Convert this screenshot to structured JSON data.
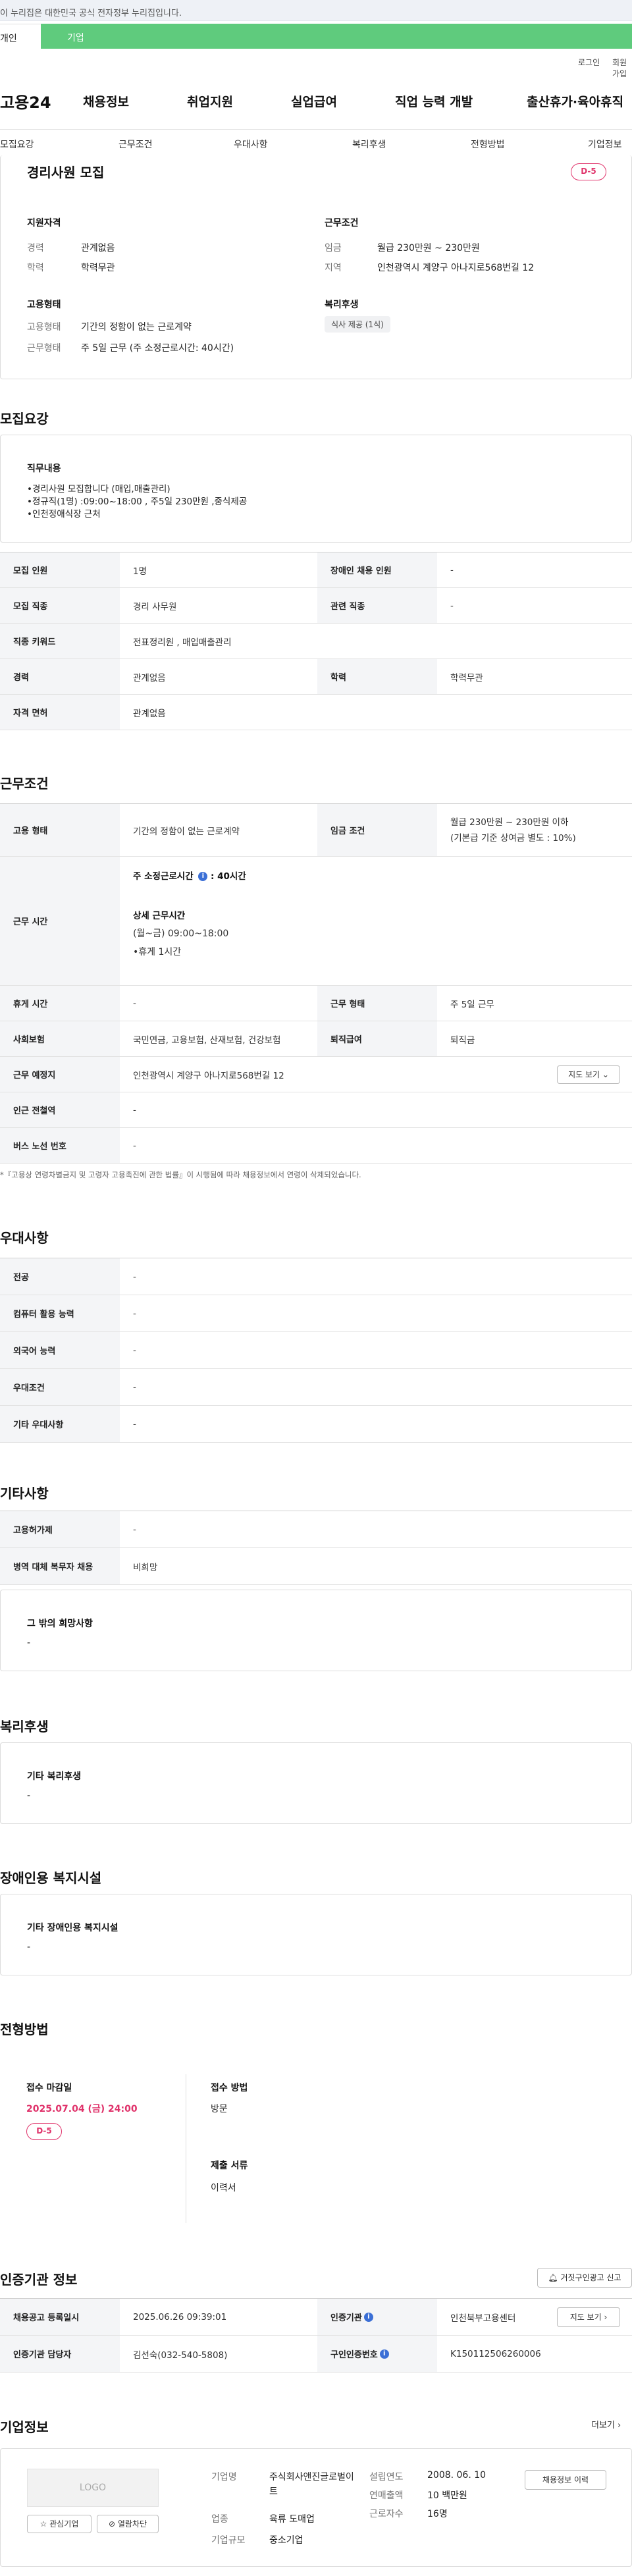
{
  "gov_banner": "이 누리집은 대한민국 공식 전자정부 누리집입니다.",
  "top_tabs": {
    "person": "개인",
    "company": "기업"
  },
  "util_links": {
    "login": "로그인",
    "join": "회원가입"
  },
  "logo": "고용24",
  "gnb": [
    "채용정보",
    "취업지원",
    "실업급여",
    "직업 능력 개발",
    "출산휴가·육아휴직"
  ],
  "anchor_nav": [
    "모집요강",
    "근무조건",
    "우대사항",
    "복리후생",
    "전형방법",
    "기업정보"
  ],
  "summary": {
    "title": "경리사원 모집",
    "dday": "D-5",
    "qual_title": "지원자격",
    "qual": [
      {
        "label": "경력",
        "value": "관계없음"
      },
      {
        "label": "학력",
        "value": "학력무관"
      }
    ],
    "work_title": "근무조건",
    "work": [
      {
        "label": "임금",
        "value": "월급 230만원 ~ 230만원"
      },
      {
        "label": "지역",
        "value": "인천광역시 계양구 아나지로568번길 12"
      }
    ],
    "emp_title": "고용형태",
    "emp": [
      {
        "label": "고용형태",
        "value": "기간의 정함이 없는 근로계약"
      },
      {
        "label": "근무형태",
        "value": "주 5일 근무 (주 소정근로시간: 40시간)"
      }
    ],
    "welfare_title": "복리후생",
    "welfare_tag": "식사 제공 (1식)"
  },
  "recruit": {
    "heading": "모집요강",
    "duty_title": "직무내용",
    "duty_lines": [
      "•경리사원 모집합니다 (매입,매출관리)",
      "•정규직(1명) :09:00~18:00 , 주5일 230만원 ,중식제공",
      "•인천정애식장 근처"
    ],
    "rows": [
      {
        "h1": "모집 인원",
        "v1": "1명",
        "h2": "장애인 채용 인원",
        "v2": "-"
      },
      {
        "h1": "모집 직종",
        "v1": "경리 사무원",
        "h2": "관련 직종",
        "v2": "-"
      },
      {
        "h1": "직종 키워드",
        "v1": "전표정리원 , 매입매출관리"
      },
      {
        "h1": "경력",
        "v1": "관계없음",
        "h2": "학력",
        "v2": "학력무관"
      },
      {
        "h1": "자격 면허",
        "v1": "관계없음"
      }
    ]
  },
  "condition": {
    "heading": "근무조건",
    "emp_type_h": "고용 형태",
    "emp_type_v": "기간의 정함이 없는 근로계약",
    "wage_h": "임금 조건",
    "wage_v1": "월급 230만원 ~ 230만원 이하",
    "wage_v2": "(기본급 기준 상여금 별도 : 10%)",
    "hours_h": "근무 시간",
    "hours_label": "주 소정근로시간",
    "hours_value": ": 40시간",
    "detail_title": "상세 근무시간",
    "detail_lines": [
      "(월~금) 09:00~18:00",
      "•휴게 1시간"
    ],
    "rows": [
      {
        "h1": "휴게 시간",
        "v1": "-",
        "h2": "근무 형태",
        "v2": "주 5일 근무"
      },
      {
        "h1": "사회보험",
        "v1": "국민연금, 고용보험, 산재보험, 건강보험",
        "h2": "퇴직급여",
        "v2": "퇴직금"
      }
    ],
    "place_h": "근무 예정지",
    "place_v": "인천광역시 계양구 아나지로568번길 12",
    "map_btn": "지도 보기",
    "station_h": "인근 전철역",
    "station_v": "-",
    "bus_h": "버스 노선 번호",
    "bus_v": "-",
    "note": "*『고용상 연령차별금지 및 고령자 고용촉진에 관한 법률』이 시행됨에 따라 채용정보에서 연령이 삭제되었습니다."
  },
  "preference": {
    "heading": "우대사항",
    "rows": [
      {
        "h": "전공",
        "v": "-"
      },
      {
        "h": "컴퓨터 활용 능력",
        "v": "-"
      },
      {
        "h": "외국어 능력",
        "v": "-"
      },
      {
        "h": "우대조건",
        "v": "-"
      },
      {
        "h": "기타 우대사항",
        "v": "-"
      }
    ]
  },
  "etc": {
    "heading": "기타사항",
    "rows": [
      {
        "h": "고용허가제",
        "v": "-"
      },
      {
        "h": "병역 대체 복무자 채용",
        "v": "비희망"
      }
    ],
    "box_title": "그 밖의 희망사항",
    "box_value": "-"
  },
  "welfare": {
    "heading": "복리후생",
    "box_title": "기타 복리후생",
    "box_value": "-"
  },
  "disabled": {
    "heading": "장애인용 복지시설",
    "box_title": "기타 장애인용 복지시설",
    "box_value": "-"
  },
  "process": {
    "heading": "전형방법",
    "deadline_title": "접수 마감일",
    "deadline": "2025.07.04 (금) 24:00",
    "dday": "D-5",
    "method_title": "접수 방법",
    "method": "방문",
    "docs_title": "제출 서류",
    "docs": "이력서"
  },
  "cert": {
    "heading": "인증기관 정보",
    "report_btn": "거짓구인광고 신고",
    "r1": {
      "h1": "채용공고 등록일시",
      "v1": "2025.06.26 09:39:01",
      "h2": "인증기관",
      "v2": "인천북부고용센터",
      "btn": "지도 보기"
    },
    "r2": {
      "h1": "인증기관 담당자",
      "v1": "김선숙(032-540-5808)",
      "h2": "구인인증번호",
      "v2": "K150112506260006"
    }
  },
  "company": {
    "heading": "기업정보",
    "more": "더보기",
    "logo_text": "LOGO",
    "fav_btn": "관심기업",
    "block_btn": "열람차단",
    "name_h": "기업명",
    "name_v": "주식회사앤진글로벌이트",
    "industry_h": "업종",
    "industry_v": "육류 도매업",
    "size_h": "기업규모",
    "size_v": "중소기업",
    "year_h": "설립연도",
    "year_v": "2008. 06. 10",
    "sales_h": "연매출액",
    "sales_v": "10 백만원",
    "staff_h": "근로자수",
    "staff_v": "16명",
    "jobs_btn": "채용정보 이력"
  }
}
